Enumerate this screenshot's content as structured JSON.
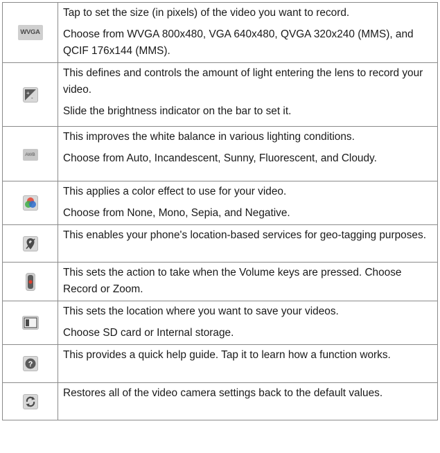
{
  "rows": [
    {
      "icon": "wvga-icon",
      "icon_label": "WVGA",
      "lines": [
        "Tap to set the size (in pixels) of the video you want to record.",
        "Choose from WVGA 800x480, VGA 640x480, QVGA 320x240 (MMS), and QCIF 176x144 (MMS)."
      ]
    },
    {
      "icon": "brightness-icon",
      "lines": [
        "This defines and controls the amount of light entering the lens to record your video.",
        "Slide the brightness indicator on the bar to set it."
      ]
    },
    {
      "icon": "white-balance-icon",
      "icon_label": "AWB",
      "lines": [
        "This improves the white balance in various lighting conditions.",
        "Choose from Auto, Incandescent, Sunny, Fluorescent, and Cloudy."
      ]
    },
    {
      "icon": "color-effect-icon",
      "lines": [
        "This applies a color effect to use for your video.",
        "Choose from None, Mono, Sepia, and Negative."
      ]
    },
    {
      "icon": "geo-tagging-icon",
      "lines": [
        "This enables your phone's location-based services for geo-tagging purposes."
      ]
    },
    {
      "icon": "volume-key-icon",
      "lines": [
        "This sets the action to take when the Volume keys are pressed. Choose Record or Zoom."
      ]
    },
    {
      "icon": "storage-icon",
      "lines": [
        "This sets the location where you want to save your videos.",
        "Choose SD card or Internal storage."
      ]
    },
    {
      "icon": "help-icon",
      "lines": [
        "This provides a quick help guide. Tap it to learn how a function works."
      ]
    },
    {
      "icon": "reset-icon",
      "lines": [
        "Restores all of the video camera settings back to the default values."
      ]
    }
  ]
}
